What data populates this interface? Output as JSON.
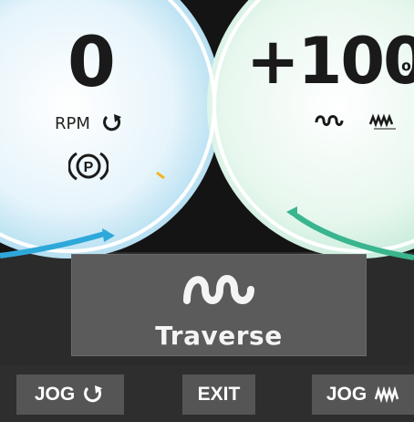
{
  "rpm_gauge": {
    "value": "0",
    "unit_label": "RPM",
    "rotation_icon": "rotate-icon",
    "parking_brake_icon": "parking-brake-icon",
    "accent_color": "#2ea8d9"
  },
  "speed_gauge": {
    "value": "+100",
    "unit": "%",
    "traverse_icon": "traverse-wave-icon",
    "jog_icon": "jog-zigzag-icon",
    "accent_color": "#3ab58e"
  },
  "mode": {
    "label": "Traverse",
    "icon": "traverse-wave-icon"
  },
  "softkeys": {
    "jog_rotate": "JOG",
    "exit": "EXIT",
    "jog_traverse": "JOG"
  }
}
